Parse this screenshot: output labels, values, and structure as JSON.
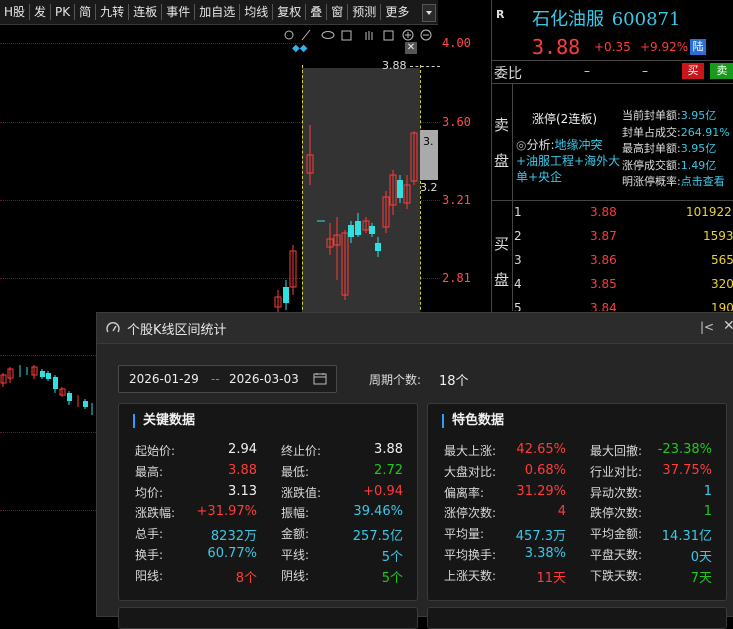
{
  "toolbar": {
    "items": [
      "H股",
      "发",
      "PK",
      "简",
      "九转",
      "连板",
      "事件",
      "加自选",
      "均线",
      "复权",
      "叠",
      "窗",
      "预测",
      "更多"
    ]
  },
  "chart": {
    "price_labels": [
      "4.00",
      "3.60",
      "3.21",
      "2.81"
    ],
    "cursor_price": "3.88",
    "right_tag_top": "3.",
    "right_tag_bottom": "3.2"
  },
  "quote": {
    "logo": "R",
    "name": "石化油服",
    "code": "600871",
    "price": "3.88",
    "change": "+0.35",
    "pct": "+9.92%",
    "tag": "陆",
    "weibi_label": "委比",
    "weibi_val": "–",
    "weiga_val": "–",
    "buy_btn": "买",
    "sell_btn": "卖",
    "sell_side_label": [
      "卖",
      "盘"
    ],
    "limit_status": "涨停(2连板)",
    "analysis_prefix": "分析:",
    "analysis_text": "地缘冲突+油服工程+海外大单+央企",
    "stats": [
      {
        "k": "当前封单额:",
        "v": "3.95亿"
      },
      {
        "k": "封单占成交:",
        "v": "264.91%"
      },
      {
        "k": "最高封单额:",
        "v": "3.95亿"
      },
      {
        "k": "涨停成交额:",
        "v": "1.49亿"
      },
      {
        "k": "明涨停概率:",
        "v": "点击查看"
      }
    ],
    "buy_side_label": [
      "买",
      "盘"
    ],
    "bids": [
      {
        "n": "1",
        "p": "3.88",
        "v": "101922"
      },
      {
        "n": "2",
        "p": "3.87",
        "v": "1593"
      },
      {
        "n": "3",
        "p": "3.86",
        "v": "565"
      },
      {
        "n": "4",
        "p": "3.85",
        "v": "320"
      },
      {
        "n": "5",
        "p": "3.84",
        "v": "190"
      }
    ]
  },
  "modal": {
    "title": "个股K线区间统计",
    "date_start": "2026-01-29",
    "date_sep": "--",
    "date_end": "2026-03-03",
    "period_label": "周期个数:",
    "period_value": "18个",
    "key_title": "关键数据",
    "feat_title": "特色数据",
    "key_rows": [
      {
        "a": "起始价:",
        "av": "2.94",
        "ac": "white",
        "b": "终止价:",
        "bv": "3.88",
        "bc": "white"
      },
      {
        "a": "最高:",
        "av": "3.88",
        "ac": "red",
        "b": "最低:",
        "bv": "2.72",
        "bc": "green"
      },
      {
        "a": "均价:",
        "av": "3.13",
        "ac": "white",
        "b": "涨跌值:",
        "bv": "+0.94",
        "bc": "red"
      },
      {
        "a": "涨跌幅:",
        "av": "+31.97%",
        "ac": "red",
        "b": "振幅:",
        "bv": "39.46%",
        "bc": "cyan"
      },
      {
        "a": "总手:",
        "av": "8232万",
        "ac": "cyan",
        "b": "金额:",
        "bv": "257.5亿",
        "bc": "cyan"
      },
      {
        "a": "换手:",
        "av": "60.77%",
        "ac": "cyan",
        "b": "平线:",
        "bv": "5个",
        "bc": "cyan"
      },
      {
        "a": "阳线:",
        "av": "8个",
        "ac": "red",
        "b": "阴线:",
        "bv": "5个",
        "bc": "green"
      }
    ],
    "feat_rows": [
      {
        "a": "最大上涨:",
        "av": "42.65%",
        "ac": "red",
        "b": "最大回撤:",
        "bv": "-23.38%",
        "bc": "green"
      },
      {
        "a": "大盘对比:",
        "av": "0.68%",
        "ac": "red",
        "b": "行业对比:",
        "bv": "37.75%",
        "bc": "red"
      },
      {
        "a": "偏离率:",
        "av": "31.29%",
        "ac": "red",
        "b": "异动次数:",
        "bv": "1",
        "bc": "cyan"
      },
      {
        "a": "涨停次数:",
        "av": "4",
        "ac": "red",
        "b": "跌停次数:",
        "bv": "1",
        "bc": "green"
      },
      {
        "a": "平均量:",
        "av": "457.3万",
        "ac": "cyan",
        "b": "平均金额:",
        "bv": "14.31亿",
        "bc": "cyan"
      },
      {
        "a": "平均换手:",
        "av": "3.38%",
        "ac": "cyan",
        "b": "平盘天数:",
        "bv": "0天",
        "bc": "cyan"
      },
      {
        "a": "上涨天数:",
        "av": "11天",
        "ac": "red",
        "b": "下跌天数:",
        "bv": "7天",
        "bc": "green"
      }
    ]
  }
}
